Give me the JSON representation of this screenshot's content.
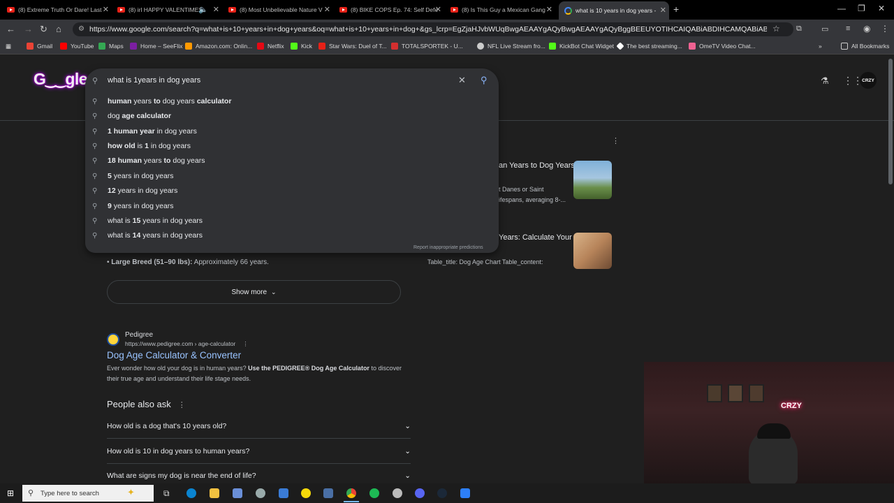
{
  "tabs": [
    {
      "label": "(8) Extreme Truth Or Dare! Last"
    },
    {
      "label": "(8) irl HAPPY VALENTIMES"
    },
    {
      "label": "(8) Most Unbelievable Nature V"
    },
    {
      "label": "(8) BIKE COPS Ep. 74: Self Defe"
    },
    {
      "label": "(8) Is This Guy a Mexican Gang"
    },
    {
      "label": "what is 10 years in dog years -"
    }
  ],
  "address": {
    "url": "https://www.google.com/search?q=what+is+10+years+in+dog+years&oq=what+is+10+years+in+dog+&gs_lcrp=EgZjaHJvbWUqBwgAEAAYgAQyBwgAEAAYgAQyBggBEEUYOTIHCAIQABiABDIHCAMQABiABDIHCAQQABiABDIICAUQA..."
  },
  "bookmarks": [
    {
      "label": "Gmail",
      "color": "#ea4335"
    },
    {
      "label": "YouTube",
      "color": "#ff0000"
    },
    {
      "label": "Maps",
      "color": "#34a853"
    },
    {
      "label": "Home – SeeFlix",
      "color": "#7b1fa2"
    },
    {
      "label": "Amazon.com: Onlin...",
      "color": "#ff9900"
    },
    {
      "label": "Netflix",
      "color": "#e50914"
    },
    {
      "label": "Kick",
      "color": "#53fc18"
    },
    {
      "label": "Star Wars: Duel of T...",
      "color": "#e62117"
    },
    {
      "label": "TOTALSPORTEK - U...",
      "color": "#d32f2f"
    },
    {
      "label": "NFL Live Stream fro...",
      "color": "#cccccc"
    },
    {
      "label": "KickBot Chat Widget",
      "color": "#53fc18"
    },
    {
      "label": "The best streaming...",
      "color": "#ffffff"
    },
    {
      "label": "OmeTV Video Chat...",
      "color": "#f06292"
    },
    {
      "label": "All Bookmarks",
      "color": "#cccccc"
    }
  ],
  "search": {
    "query": "what is 1years in dog years",
    "suggestions": [
      {
        "pre": "",
        "bold1": "human",
        "mid": " years ",
        "bold2": "to",
        "post": " dog years ",
        "bold3": "calculator"
      },
      {
        "pre": "dog ",
        "bold1": "age calculator",
        "mid": "",
        "bold2": "",
        "post": "",
        "bold3": ""
      },
      {
        "pre": "",
        "bold1": "1 human year",
        "mid": " in dog years",
        "bold2": "",
        "post": "",
        "bold3": ""
      },
      {
        "pre": "",
        "bold1": "how old",
        "mid": " is ",
        "bold2": "1",
        "post": " in dog years",
        "bold3": ""
      },
      {
        "pre": "",
        "bold1": "18 human",
        "mid": " years ",
        "bold2": "to",
        "post": " dog years",
        "bold3": ""
      },
      {
        "pre": "",
        "bold1": "5",
        "mid": " years in dog years",
        "bold2": "",
        "post": "",
        "bold3": ""
      },
      {
        "pre": "",
        "bold1": "12",
        "mid": " years in dog years",
        "bold2": "",
        "post": "",
        "bold3": ""
      },
      {
        "pre": "",
        "bold1": "9",
        "mid": " years in dog years",
        "bold2": "",
        "post": "",
        "bold3": ""
      },
      {
        "pre": "what is ",
        "bold1": "15",
        "mid": " years in dog years",
        "bold2": "",
        "post": "",
        "bold3": ""
      },
      {
        "pre": "what is ",
        "bold1": "14",
        "mid": " years in dog years",
        "bold2": "",
        "post": "",
        "bold3": ""
      }
    ],
    "report": "Report inappropriate predictions"
  },
  "right_cards": [
    {
      "title": "an Years to Dog Years",
      "text": "t Danes or Saint\nifespans, averaging 8-..."
    },
    {
      "title": "Years: Calculate Your",
      "text": "Table_title: Dog Age Chart Table_content:"
    }
  ],
  "partial_item": {
    "bold": "Large Breed (51–90 lbs):",
    "rest": " Approximately 66 years."
  },
  "show_more": "Show more",
  "result": {
    "site": "Pedigree",
    "url": "https://www.pedigree.com › age-calculator",
    "title": "Dog Age Calculator & Converter",
    "snippet_pre": "Ever wonder how old your dog is in human years? ",
    "snippet_bold": "Use the PEDIGREE® Dog Age Calculator",
    "snippet_post": " to discover their true age and understand their life stage needs."
  },
  "paa": {
    "heading": "People also ask",
    "questions": [
      "How old is a dog that's 10 years old?",
      "How old is 10 in dog years to human years?",
      "What are signs my dog is near the end of life?"
    ]
  },
  "profile": {
    "label": "CRZY"
  },
  "taskbar": {
    "search_placeholder": "Type here to search"
  },
  "webcam": {
    "sign": "CRZY"
  }
}
